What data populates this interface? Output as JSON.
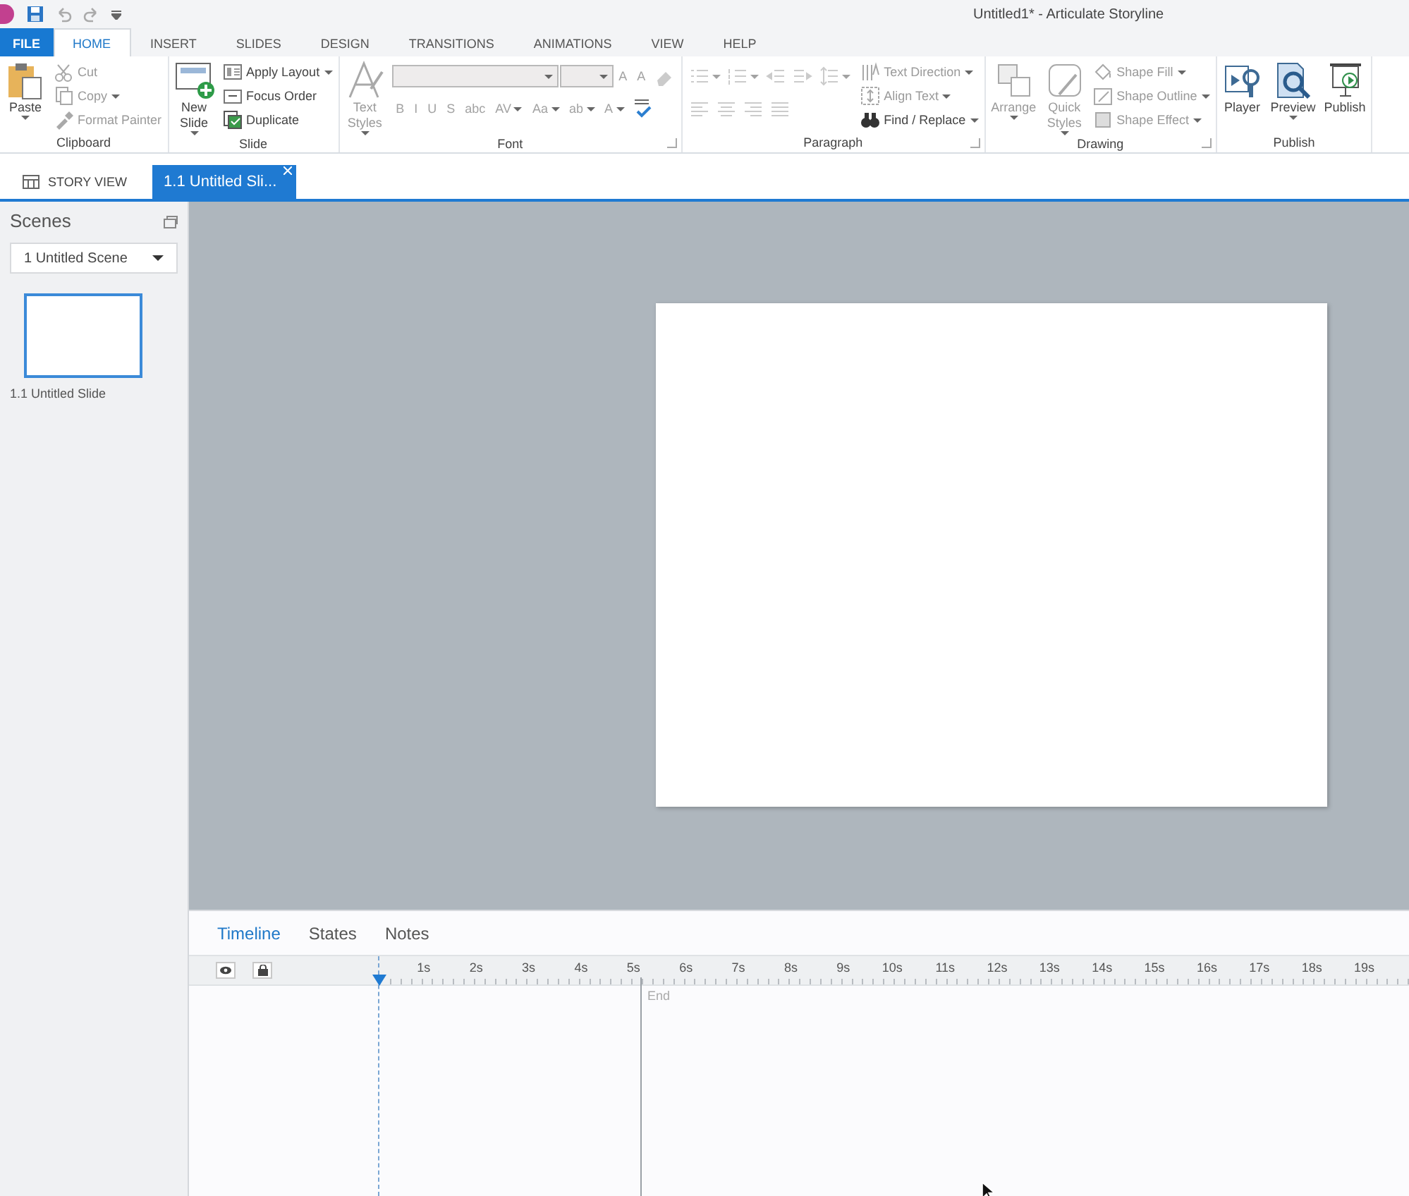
{
  "window": {
    "title": "Untitled1* -  Articulate Storyline"
  },
  "ribbon_tabs": [
    {
      "label": "FILE",
      "kind": "file",
      "selected": false
    },
    {
      "label": "HOME",
      "kind": "tab",
      "selected": true
    },
    {
      "label": "INSERT",
      "kind": "tab",
      "selected": false
    },
    {
      "label": "SLIDES",
      "kind": "tab",
      "selected": false
    },
    {
      "label": "DESIGN",
      "kind": "tab",
      "selected": false
    },
    {
      "label": "TRANSITIONS",
      "kind": "tab",
      "selected": false
    },
    {
      "label": "ANIMATIONS",
      "kind": "tab",
      "selected": false
    },
    {
      "label": "VIEW",
      "kind": "tab",
      "selected": false
    },
    {
      "label": "HELP",
      "kind": "tab",
      "selected": false
    }
  ],
  "ribbon_groups": [
    {
      "label": "Clipboard",
      "columns": [
        [
          {
            "kind": "large",
            "label": "Paste",
            "dropdown": true,
            "disabled": false
          }
        ],
        [
          {
            "kind": "small",
            "label": "Cut",
            "disabled": true
          },
          {
            "kind": "small",
            "label": "Copy",
            "dropdown": true,
            "disabled": true
          },
          {
            "kind": "small",
            "label": "Format Painter",
            "disabled": true
          }
        ]
      ]
    },
    {
      "label": "Slide",
      "columns": [
        [
          {
            "kind": "large",
            "label": "New Slide",
            "dropdown": true,
            "disabled": false
          }
        ],
        [
          {
            "kind": "small",
            "label": "Apply Layout",
            "dropdown": true,
            "disabled": false
          },
          {
            "kind": "small",
            "label": "Focus Order",
            "disabled": false
          },
          {
            "kind": "small",
            "label": "Duplicate",
            "disabled": false
          }
        ]
      ]
    },
    {
      "label": "Font",
      "launcher": true,
      "columns": [
        [
          {
            "kind": "large",
            "label": "Text Styles",
            "dropdown": true,
            "disabled": true
          }
        ],
        [
          {
            "kind": "row",
            "items": [
              {
                "kind": "combo",
                "wide": true,
                "disabled": true
              },
              {
                "kind": "combo",
                "wide": false,
                "disabled": true
              },
              {
                "kind": "glyph",
                "label": "A",
                "disabled": true
              },
              {
                "kind": "glyph",
                "label": "A",
                "disabled": true
              },
              {
                "kind": "icon",
                "disabled": true
              }
            ]
          },
          {
            "kind": "row",
            "items": [
              {
                "kind": "glyph",
                "label": "B",
                "disabled": true
              },
              {
                "kind": "glyph",
                "label": "I",
                "disabled": true
              },
              {
                "kind": "glyph",
                "label": "U",
                "disabled": true
              },
              {
                "kind": "glyph",
                "label": "S",
                "disabled": true
              },
              {
                "kind": "glyph",
                "label": "abc",
                "disabled": true
              },
              {
                "kind": "glyph",
                "label": "AV",
                "dropdown": true,
                "disabled": true
              },
              {
                "kind": "glyph",
                "label": "Aa",
                "dropdown": true,
                "disabled": true
              },
              {
                "kind": "glyph",
                "label": "ab",
                "dropdown": true,
                "disabled": true
              },
              {
                "kind": "glyph",
                "label": "A",
                "dropdown": true,
                "disabled": true
              },
              {
                "kind": "icon",
                "disabled": false
              }
            ]
          }
        ]
      ]
    },
    {
      "label": "Paragraph",
      "launcher": true,
      "columns": [
        [
          {
            "kind": "row",
            "items": [
              {
                "kind": "icon",
                "dropdown": true,
                "disabled": true
              },
              {
                "kind": "icon",
                "dropdown": true,
                "disabled": true
              },
              {
                "kind": "icon",
                "disabled": true
              },
              {
                "kind": "icon",
                "disabled": true
              },
              {
                "kind": "icon",
                "dropdown": true,
                "disabled": true
              }
            ]
          },
          {
            "kind": "row",
            "items": [
              {
                "kind": "icon",
                "disabled": true
              },
              {
                "kind": "icon",
                "disabled": true
              },
              {
                "kind": "icon",
                "disabled": true
              },
              {
                "kind": "icon",
                "disabled": true
              }
            ]
          }
        ],
        [
          {
            "kind": "small",
            "label": "Text Direction",
            "dropdown": true,
            "disabled": true
          },
          {
            "kind": "small",
            "label": "Align Text",
            "dropdown": true,
            "disabled": true
          },
          {
            "kind": "small",
            "label": "Find / Replace",
            "dropdown": true,
            "disabled": false
          }
        ]
      ]
    },
    {
      "label": "Drawing",
      "launcher": true,
      "columns": [
        [
          {
            "kind": "large",
            "label": "Arrange",
            "dropdown": true,
            "disabled": true
          }
        ],
        [
          {
            "kind": "large",
            "label": "Quick Styles",
            "dropdown": true,
            "disabled": true
          }
        ],
        [
          {
            "kind": "small",
            "label": "Shape Fill",
            "dropdown": true,
            "disabled": true
          },
          {
            "kind": "small",
            "label": "Shape Outline",
            "dropdown": true,
            "disabled": true
          },
          {
            "kind": "small",
            "label": "Shape Effect",
            "dropdown": true,
            "disabled": true
          }
        ]
      ]
    },
    {
      "label": "Publish",
      "columns": [
        [
          {
            "kind": "large",
            "label": "Player",
            "disabled": false
          }
        ],
        [
          {
            "kind": "large",
            "label": "Preview",
            "dropdown": true,
            "disabled": false
          }
        ],
        [
          {
            "kind": "large",
            "label": "Publish",
            "disabled": false
          }
        ]
      ]
    }
  ],
  "document_tabs": [
    {
      "label": "STORY VIEW",
      "kind": "story",
      "selected": false
    },
    {
      "label": "1.1 Untitled Sli...",
      "kind": "slide",
      "selected": true,
      "closable": true
    }
  ],
  "scenes_panel": {
    "title": "Scenes",
    "scene_dropdown": "1 Untitled Scene",
    "slides": [
      {
        "label": "1.1 Untitled Slide",
        "selected": true
      }
    ]
  },
  "bottom_tabs": [
    {
      "label": "Timeline",
      "selected": true
    },
    {
      "label": "States",
      "selected": false
    },
    {
      "label": "Notes",
      "selected": false
    }
  ],
  "timeline": {
    "ticks": [
      "1s",
      "2s",
      "3s",
      "4s",
      "5s",
      "6s",
      "7s",
      "8s",
      "9s",
      "10s",
      "11s",
      "12s",
      "13s",
      "14s",
      "15s",
      "16s",
      "17s",
      "18s",
      "19s"
    ],
    "end_label": "End"
  }
}
